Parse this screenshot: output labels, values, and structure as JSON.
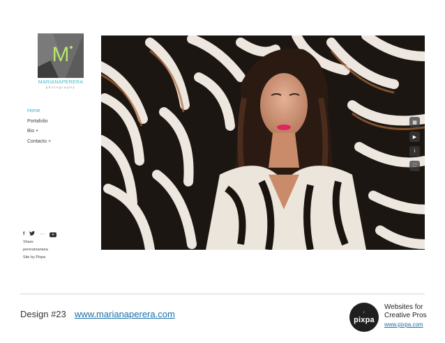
{
  "logo": {
    "monogram": "M",
    "name_part1": "MARIANA",
    "name_part2": "PERERA",
    "subtitle": "photography"
  },
  "nav": {
    "items": [
      {
        "label": "Home",
        "active": true
      },
      {
        "label": "Portafolio",
        "active": false
      },
      {
        "label": "Bio +",
        "active": false
      },
      {
        "label": "Contacto +",
        "active": false
      }
    ]
  },
  "social": {
    "icons": [
      "facebook-icon",
      "twitter-icon",
      "more-icon",
      "youtube-icon"
    ],
    "facebook": "f",
    "more": "···"
  },
  "sidebar_footer": {
    "share": "Share",
    "handle": "pereramariana",
    "credit": "Site by Pixpa"
  },
  "slideshow_controls": {
    "icons": [
      "grid-icon",
      "play-icon",
      "info-icon",
      "fullscreen-icon"
    ]
  },
  "footer": {
    "design_label": "Design #23",
    "site_url": "www.marianaperera.com",
    "brand": "pixpa",
    "tagline_line1": "Websites for",
    "tagline_line2": "Creative Pros",
    "brand_url": "www.pixpa.com"
  },
  "colors": {
    "accent": "#35b6c6",
    "link": "#1a6fa8"
  }
}
